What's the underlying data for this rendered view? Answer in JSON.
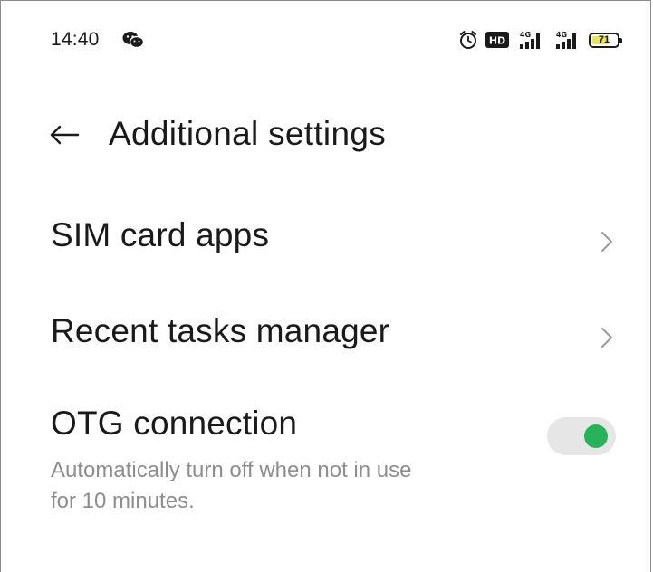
{
  "status_bar": {
    "time": "14:40",
    "notification_icon": "wechat-icon",
    "alarm_icon": "alarm-icon",
    "hd_badge": "HD",
    "signal1_label": "4G",
    "signal2_label": "4G",
    "battery_level": "71",
    "battery_percent": 71
  },
  "header": {
    "back_icon": "back-arrow-icon",
    "title": "Additional settings"
  },
  "settings": {
    "sim_card_apps": {
      "label": "SIM card apps",
      "icon": "chevron-right-icon"
    },
    "recent_tasks_manager": {
      "label": "Recent tasks manager",
      "icon": "chevron-right-icon"
    },
    "otg_connection": {
      "label": "OTG connection",
      "description_line1": "Automatically turn off when not in use",
      "description_line2": "for 10 minutes.",
      "enabled": true,
      "toggle_on_color": "#26b35a",
      "toggle_track_color": "#e6e6e6"
    }
  }
}
